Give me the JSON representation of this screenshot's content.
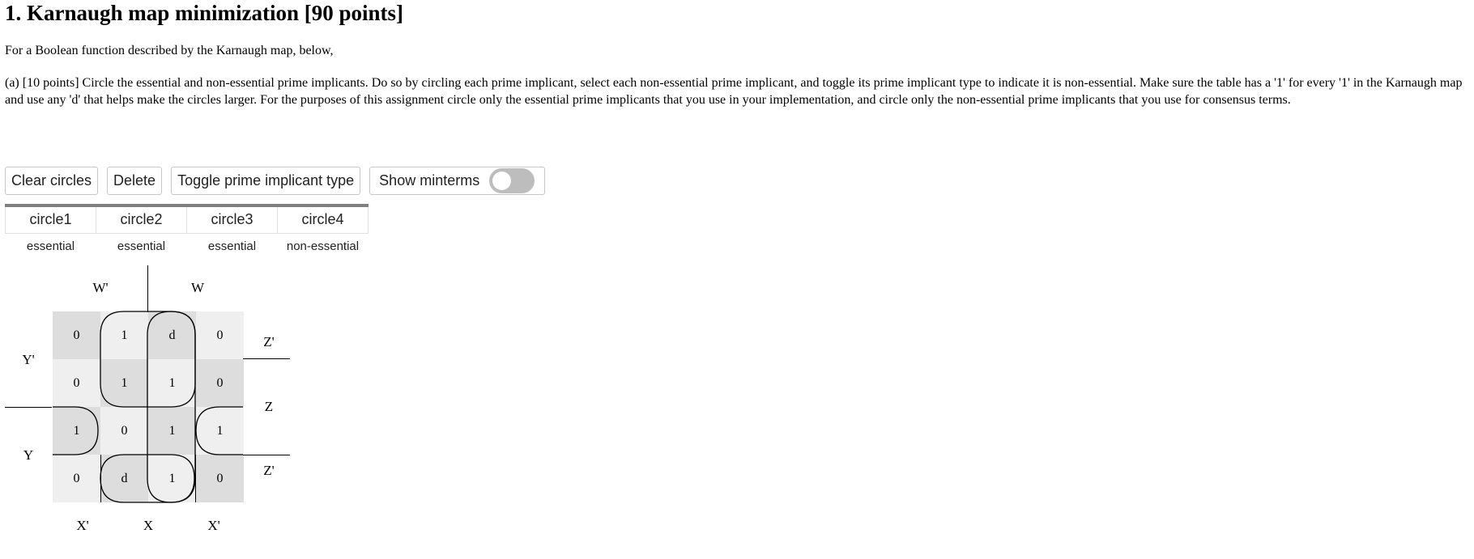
{
  "heading": "1. Karnaugh map minimization [90 points]",
  "intro": "For a Boolean function described by the Karnaugh map, below,",
  "part_a": "(a) [10 points] Circle the essential and non-essential prime implicants. Do so by circling each prime implicant, select each non-essential prime implicant, and toggle its prime implicant type to indicate it is non-essential. Make sure the table has a '1' for every '1' in the Karnaugh map and use any 'd' that helps make the circles larger. For the purposes of this assignment circle only the essential prime implicants that you use in your implementation, and circle only the non-essential prime implicants that you use for consensus terms.",
  "toolbar": {
    "clear_label": "Clear circles",
    "delete_label": "Delete",
    "toggle_type_label": "Toggle prime implicant type",
    "show_minterms_label": "Show minterms",
    "show_minterms_on": false
  },
  "circles_table": {
    "names": [
      "circle1",
      "circle2",
      "circle3",
      "circle4"
    ],
    "types": [
      "essential",
      "essential",
      "essential",
      "non-essential"
    ]
  },
  "kmap": {
    "labels": {
      "w_prime": "W'",
      "w": "W",
      "y_prime": "Y'",
      "y": "Y",
      "z_prime_top": "Z'",
      "z": "Z",
      "z_prime_bottom": "Z'",
      "x_prime_left": "X'",
      "x": "X",
      "x_prime_right": "X'"
    },
    "rows": [
      [
        "0",
        "1",
        "d",
        "0"
      ],
      [
        "0",
        "1",
        "1",
        "0"
      ],
      [
        "1",
        "0",
        "1",
        "1"
      ],
      [
        "0",
        "d",
        "1",
        "0"
      ]
    ],
    "shading": [
      [
        "dark",
        "light",
        "dark",
        "light"
      ],
      [
        "light",
        "dark",
        "light",
        "dark"
      ],
      [
        "dark",
        "light",
        "dark",
        "light"
      ],
      [
        "light",
        "dark",
        "light",
        "dark"
      ]
    ],
    "cell_colors": {
      "dark": "#dddddd",
      "light": "#efefef"
    }
  }
}
